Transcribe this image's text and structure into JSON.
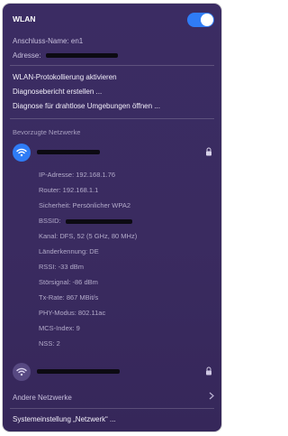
{
  "header": {
    "title": "WLAN",
    "toggle_on": true
  },
  "interface": {
    "name_label": "Anschluss-Name: en1",
    "address_label": "Adresse:"
  },
  "menu": {
    "logging": "WLAN-Protokollierung aktivieren",
    "diag_report": "Diagnosebericht erstellen ...",
    "wireless_diag": "Diagnose für drahtlose Umgebungen öffnen ..."
  },
  "preferred": {
    "section_label": "Bevorzugte Netzwerke",
    "connected_details": [
      "IP-Adresse: 192.168.1.76",
      "Router: 192.168.1.1",
      "Sicherheit: Persönlicher WPA2",
      "BSSID:",
      "Kanal: DFS, 52 (5 GHz, 80 MHz)",
      "Länderkennung: DE",
      "RSSI: -33 dBm",
      "Störsignal: -86 dBm",
      "Tx-Rate: 867 MBit/s",
      "PHY-Modus: 802.11ac",
      "MCS-Index: 9",
      "NSS: 2"
    ]
  },
  "other_networks": {
    "label": "Andere Netzwerke"
  },
  "settings": {
    "label": "Systemeinstellung „Netzwerk“ ..."
  },
  "colors": {
    "accent": "#2f7cf6",
    "panel": "#3b2c63"
  }
}
